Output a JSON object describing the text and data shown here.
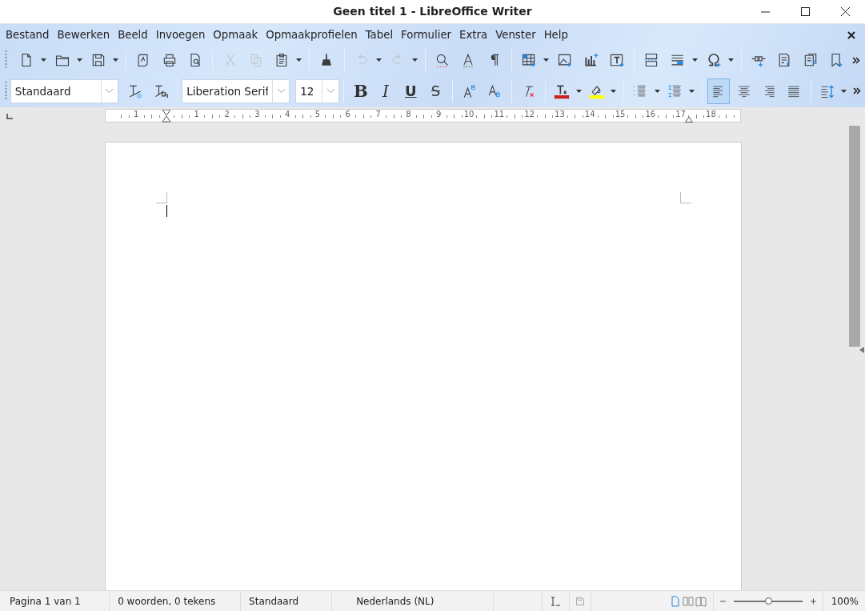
{
  "window": {
    "title": "Geen titel 1 - LibreOffice Writer"
  },
  "menu": [
    "Bestand",
    "Bewerken",
    "Beeld",
    "Invoegen",
    "Opmaak",
    "Opmaakprofielen",
    "Tabel",
    "Formulier",
    "Extra",
    "Venster",
    "Help"
  ],
  "toolbar_standard": [
    {
      "kind": "new",
      "disabled": false,
      "dropdown": true
    },
    {
      "kind": "open",
      "disabled": false,
      "dropdown": true
    },
    {
      "kind": "save",
      "disabled": false,
      "dropdown": true
    },
    {
      "kind": "separator"
    },
    {
      "kind": "pdf",
      "disabled": false,
      "dropdown": false
    },
    {
      "kind": "print",
      "disabled": false,
      "dropdown": false
    },
    {
      "kind": "preview",
      "disabled": false,
      "dropdown": false
    },
    {
      "kind": "separator"
    },
    {
      "kind": "cut",
      "disabled": true,
      "dropdown": false
    },
    {
      "kind": "copy",
      "disabled": true,
      "dropdown": false
    },
    {
      "kind": "paste",
      "disabled": false,
      "dropdown": true
    },
    {
      "kind": "separator"
    },
    {
      "kind": "clone",
      "disabled": false,
      "dropdown": false
    },
    {
      "kind": "separator"
    },
    {
      "kind": "undo",
      "disabled": true,
      "dropdown": true
    },
    {
      "kind": "redo",
      "disabled": true,
      "dropdown": true
    },
    {
      "kind": "separator"
    },
    {
      "kind": "find",
      "disabled": false,
      "dropdown": false
    },
    {
      "kind": "spelling",
      "disabled": false,
      "dropdown": false
    },
    {
      "kind": "pilcrow",
      "disabled": false,
      "dropdown": false
    },
    {
      "kind": "separator"
    },
    {
      "kind": "table",
      "disabled": false,
      "dropdown": true
    },
    {
      "kind": "image",
      "disabled": false,
      "dropdown": false
    },
    {
      "kind": "chart",
      "disabled": false,
      "dropdown": false
    },
    {
      "kind": "textbox",
      "disabled": false,
      "dropdown": false
    },
    {
      "kind": "separator"
    },
    {
      "kind": "pagebreak",
      "disabled": false,
      "dropdown": false
    },
    {
      "kind": "field",
      "disabled": false,
      "dropdown": true
    },
    {
      "kind": "omega",
      "disabled": false,
      "dropdown": true
    },
    {
      "kind": "separator"
    },
    {
      "kind": "link",
      "disabled": false,
      "dropdown": false
    },
    {
      "kind": "footnote",
      "disabled": false,
      "dropdown": false
    },
    {
      "kind": "comment",
      "disabled": false,
      "dropdown": false
    },
    {
      "kind": "bookmark",
      "disabled": false,
      "dropdown": false
    }
  ],
  "paragraph_style": {
    "value": "Standaard"
  },
  "font_name": {
    "value": "Liberation Serif"
  },
  "font_size": {
    "value": "12"
  },
  "toolbar_formatting": [
    {
      "kind": "separator"
    },
    {
      "kind": "bold",
      "label": "B",
      "dropdown": false,
      "selected": false
    },
    {
      "kind": "italic",
      "label": "I",
      "dropdown": false,
      "selected": false
    },
    {
      "kind": "underline",
      "label": "U",
      "dropdown": false,
      "selected": false
    },
    {
      "kind": "strike",
      "label": "S",
      "dropdown": false,
      "selected": false
    },
    {
      "kind": "separator"
    },
    {
      "kind": "superscript",
      "dropdown": false,
      "selected": false
    },
    {
      "kind": "subscript",
      "dropdown": false,
      "selected": false
    },
    {
      "kind": "separator"
    },
    {
      "kind": "clear",
      "dropdown": false,
      "selected": false
    },
    {
      "kind": "separator"
    },
    {
      "kind": "fontcolor",
      "dropdown": true,
      "selected": false
    },
    {
      "kind": "highlight",
      "dropdown": true,
      "selected": false
    },
    {
      "kind": "separator"
    },
    {
      "kind": "bullets",
      "dropdown": true,
      "selected": false
    },
    {
      "kind": "numbering",
      "dropdown": true,
      "selected": false
    },
    {
      "kind": "separator"
    },
    {
      "kind": "alignleft",
      "dropdown": false,
      "selected": true
    },
    {
      "kind": "aligncenter",
      "dropdown": false,
      "selected": false
    },
    {
      "kind": "alignright",
      "dropdown": false,
      "selected": false
    },
    {
      "kind": "justify",
      "dropdown": false,
      "selected": false
    },
    {
      "kind": "separator"
    },
    {
      "kind": "linespacing",
      "dropdown": true,
      "selected": false
    }
  ],
  "ruler": {
    "labels": [
      "1",
      "1",
      "2",
      "3",
      "4",
      "5",
      "6",
      "7",
      "8",
      "9",
      "10",
      "11",
      "12",
      "13",
      "14",
      "15",
      "16",
      "17",
      "18"
    ]
  },
  "status_bar": {
    "page": "Pagina 1 van 1",
    "words": "0 woorden, 0 tekens",
    "style": "Standaard",
    "language": "Nederlands (NL)",
    "views": [
      {
        "kind": "single",
        "selected": true
      },
      {
        "kind": "multi",
        "selected": false
      },
      {
        "kind": "book",
        "selected": false
      }
    ],
    "zoom": {
      "level": 0.5,
      "reading": "100%"
    }
  }
}
